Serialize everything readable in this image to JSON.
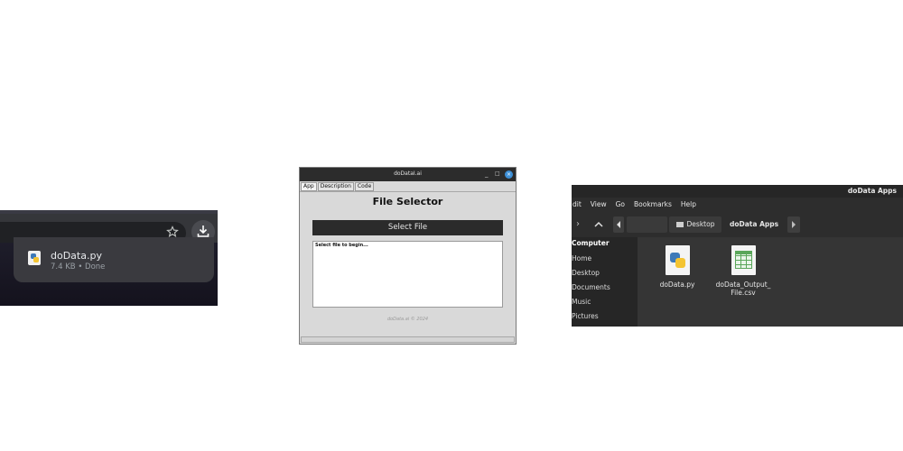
{
  "browser": {
    "download": {
      "filename": "doData.py",
      "meta": "7.4 KB • Done"
    },
    "icons": {
      "bookmark": "star-icon",
      "downloads": "download-icon",
      "file": "python-file-icon"
    }
  },
  "app_window": {
    "title": "doDataI.ai",
    "controls": {
      "minimize": "_",
      "maximize": "□",
      "close": "×"
    },
    "tabs": [
      {
        "label": "App"
      },
      {
        "label": "Description"
      },
      {
        "label": "Code"
      }
    ],
    "heading": "File Selector",
    "select_button": "Select File",
    "output_text": "Select file to begin...",
    "footer": "doData.ai © 2024"
  },
  "file_manager": {
    "title": "doData Apps",
    "menu": [
      "dit",
      "View",
      "Go",
      "Bookmarks",
      "Help"
    ],
    "path": {
      "parent": "Desktop",
      "current": "doData Apps"
    },
    "sidebar": {
      "heading": "Computer",
      "items": [
        "Home",
        "Desktop",
        "Documents",
        "Music",
        "Pictures"
      ]
    },
    "files": [
      {
        "name": "doData.py",
        "icon": "python-file-icon"
      },
      {
        "name_line1": "doData_Output_",
        "name_line2": "File.csv",
        "icon": "spreadsheet-file-icon"
      }
    ]
  },
  "colors": {
    "browser_bg": "#35363a",
    "download_card": "#3a3a3f",
    "app_button": "#2b2b2b",
    "fm_bg": "#2d2d2d"
  }
}
